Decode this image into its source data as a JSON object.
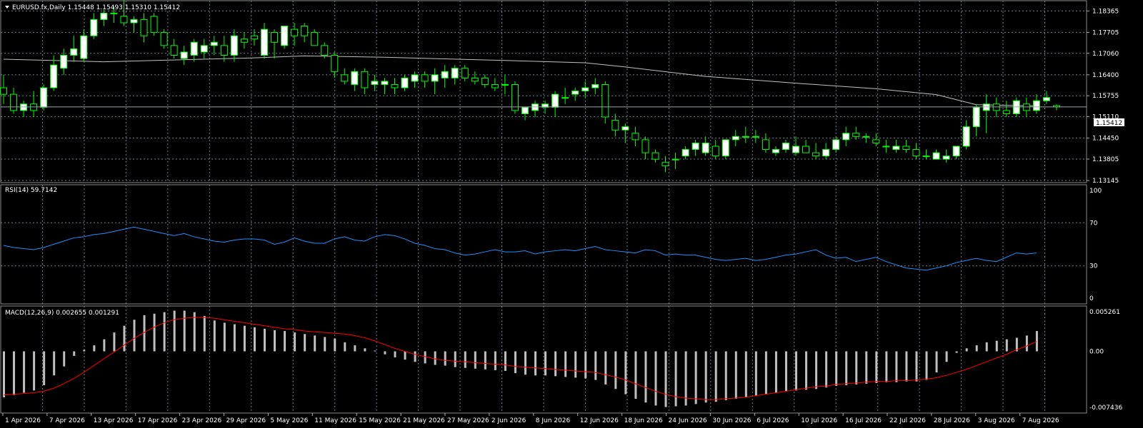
{
  "colors": {
    "background": "#000000",
    "grid": "#6f7f8f",
    "bull_body": "#ffffff",
    "bear_body": "#000000",
    "wick": "#00ff00",
    "ma_line": "#c0c0c0",
    "rsi_line": "#1e90ff",
    "macd_hist": "#c0c0c0",
    "macd_signal": "#ff0000",
    "price_box_bg": "#ffffff",
    "price_box_text": "#000000",
    "text": "#ffffff"
  },
  "header": {
    "price_text": "EURUSD.fx,Daily  1.15448 1.15493 1.15310 1.15412",
    "rsi_text": "RSI(14) 59.7142",
    "macd_text": "MACD(12,26,9) 0.002655 0.001291"
  },
  "price_box": "1.15412",
  "chart_data": [
    {
      "type": "candlestick",
      "symbol": "EURUSD.fx",
      "timeframe": "Daily",
      "yticks": [
        "1.18365",
        "1.17705",
        "1.17060",
        "1.16400",
        "1.15755",
        "1.15110",
        "1.14450",
        "1.13805",
        "1.13145"
      ],
      "ylim": [
        1.1308,
        1.1868
      ],
      "xticks": [
        "1 Apr 2026",
        "7 Apr 2026",
        "13 Apr 2026",
        "17 Apr 2026",
        "23 Apr 2026",
        "29 Apr 2026",
        "5 May 2026",
        "11 May 2026",
        "15 May 2026",
        "21 May 2026",
        "27 May 2026",
        "2 Jun 2026",
        "8 Jun 2026",
        "12 Jun 2026",
        "18 Jun 2026",
        "24 Jun 2026",
        "30 Jun 2026",
        "6 Jul 2026",
        "10 Jul 2026",
        "16 Jul 2026",
        "22 Jul 2026",
        "28 Jul 2026",
        "3 Aug 2026",
        "7 Aug 2026"
      ],
      "ohlc": [
        [
          1.16,
          1.164,
          1.155,
          1.158
        ],
        [
          1.158,
          1.16,
          1.152,
          1.153
        ],
        [
          1.153,
          1.156,
          1.151,
          1.155
        ],
        [
          1.155,
          1.159,
          1.151,
          1.153
        ],
        [
          1.154,
          1.161,
          1.153,
          1.16
        ],
        [
          1.16,
          1.17,
          1.159,
          1.167
        ],
        [
          1.166,
          1.172,
          1.164,
          1.17
        ],
        [
          1.17,
          1.176,
          1.168,
          1.172
        ],
        [
          1.169,
          1.178,
          1.168,
          1.176
        ],
        [
          1.176,
          1.183,
          1.175,
          1.181
        ],
        [
          1.181,
          1.184,
          1.179,
          1.183
        ],
        [
          1.183,
          1.185,
          1.18,
          1.183
        ],
        [
          1.182,
          1.187,
          1.179,
          1.18
        ],
        [
          1.18,
          1.182,
          1.177,
          1.181
        ],
        [
          1.181,
          1.183,
          1.174,
          1.176
        ],
        [
          1.182,
          1.183,
          1.176,
          1.177
        ],
        [
          1.177,
          1.178,
          1.172,
          1.173
        ],
        [
          1.173,
          1.175,
          1.169,
          1.17
        ],
        [
          1.169,
          1.173,
          1.167,
          1.171
        ],
        [
          1.17,
          1.175,
          1.168,
          1.174
        ],
        [
          1.171,
          1.175,
          1.169,
          1.173
        ],
        [
          1.173,
          1.176,
          1.17,
          1.174
        ],
        [
          1.173,
          1.176,
          1.168,
          1.17
        ],
        [
          1.17,
          1.178,
          1.168,
          1.176
        ],
        [
          1.175,
          1.177,
          1.172,
          1.174
        ],
        [
          1.176,
          1.178,
          1.173,
          1.175
        ],
        [
          1.17,
          1.18,
          1.169,
          1.178
        ],
        [
          1.177,
          1.178,
          1.169,
          1.174
        ],
        [
          1.173,
          1.179,
          1.172,
          1.179
        ],
        [
          1.178,
          1.18,
          1.173,
          1.176
        ],
        [
          1.179,
          1.18,
          1.174,
          1.176
        ],
        [
          1.177,
          1.178,
          1.173,
          1.173
        ],
        [
          1.173,
          1.174,
          1.169,
          1.17
        ],
        [
          1.17,
          1.171,
          1.163,
          1.165
        ],
        [
          1.164,
          1.166,
          1.161,
          1.162
        ],
        [
          1.161,
          1.166,
          1.159,
          1.165
        ],
        [
          1.165,
          1.166,
          1.158,
          1.16
        ],
        [
          1.161,
          1.164,
          1.159,
          1.162
        ],
        [
          1.161,
          1.163,
          1.158,
          1.162
        ],
        [
          1.161,
          1.163,
          1.158,
          1.16
        ],
        [
          1.16,
          1.164,
          1.159,
          1.163
        ],
        [
          1.162,
          1.165,
          1.16,
          1.164
        ],
        [
          1.164,
          1.165,
          1.16,
          1.162
        ],
        [
          1.162,
          1.166,
          1.158,
          1.164
        ],
        [
          1.163,
          1.167,
          1.16,
          1.165
        ],
        [
          1.163,
          1.167,
          1.161,
          1.166
        ],
        [
          1.166,
          1.167,
          1.162,
          1.163
        ],
        [
          1.163,
          1.165,
          1.161,
          1.162
        ],
        [
          1.163,
          1.164,
          1.16,
          1.161
        ],
        [
          1.161,
          1.163,
          1.159,
          1.16
        ],
        [
          1.161,
          1.164,
          1.158,
          1.161
        ],
        [
          1.161,
          1.162,
          1.152,
          1.153
        ],
        [
          1.152,
          1.154,
          1.15,
          1.154
        ],
        [
          1.153,
          1.156,
          1.151,
          1.155
        ],
        [
          1.154,
          1.156,
          1.152,
          1.155
        ],
        [
          1.154,
          1.159,
          1.151,
          1.158
        ],
        [
          1.157,
          1.16,
          1.155,
          1.157
        ],
        [
          1.158,
          1.16,
          1.156,
          1.159
        ],
        [
          1.159,
          1.162,
          1.157,
          1.16
        ],
        [
          1.16,
          1.163,
          1.158,
          1.161
        ],
        [
          1.161,
          1.162,
          1.149,
          1.151
        ],
        [
          1.15,
          1.152,
          1.145,
          1.147
        ],
        [
          1.147,
          1.149,
          1.143,
          1.148
        ],
        [
          1.146,
          1.148,
          1.142,
          1.144
        ],
        [
          1.144,
          1.145,
          1.138,
          1.14
        ],
        [
          1.14,
          1.141,
          1.137,
          1.138
        ],
        [
          1.137,
          1.139,
          1.134,
          1.136
        ],
        [
          1.138,
          1.14,
          1.135,
          1.138
        ],
        [
          1.139,
          1.142,
          1.138,
          1.141
        ],
        [
          1.141,
          1.144,
          1.139,
          1.143
        ],
        [
          1.14,
          1.145,
          1.139,
          1.143
        ],
        [
          1.142,
          1.144,
          1.138,
          1.139
        ],
        [
          1.139,
          1.144,
          1.138,
          1.144
        ],
        [
          1.144,
          1.147,
          1.142,
          1.145
        ],
        [
          1.145,
          1.148,
          1.143,
          1.145
        ],
        [
          1.145,
          1.147,
          1.143,
          1.145
        ],
        [
          1.144,
          1.146,
          1.14,
          1.141
        ],
        [
          1.14,
          1.142,
          1.139,
          1.141
        ],
        [
          1.141,
          1.144,
          1.14,
          1.143
        ],
        [
          1.14,
          1.145,
          1.139,
          1.142
        ],
        [
          1.142,
          1.144,
          1.14,
          1.14
        ],
        [
          1.14,
          1.143,
          1.138,
          1.139
        ],
        [
          1.139,
          1.143,
          1.138,
          1.141
        ],
        [
          1.141,
          1.145,
          1.14,
          1.144
        ],
        [
          1.144,
          1.148,
          1.142,
          1.146
        ],
        [
          1.146,
          1.148,
          1.144,
          1.145
        ],
        [
          1.145,
          1.146,
          1.143,
          1.145
        ],
        [
          1.144,
          1.146,
          1.142,
          1.143
        ],
        [
          1.142,
          1.144,
          1.14,
          1.142
        ],
        [
          1.141,
          1.144,
          1.14,
          1.142
        ],
        [
          1.142,
          1.144,
          1.14,
          1.141
        ],
        [
          1.141,
          1.143,
          1.138,
          1.139
        ],
        [
          1.139,
          1.141,
          1.138,
          1.139
        ],
        [
          1.138,
          1.141,
          1.138,
          1.14
        ],
        [
          1.138,
          1.141,
          1.137,
          1.139
        ],
        [
          1.139,
          1.142,
          1.138,
          1.142
        ],
        [
          1.142,
          1.15,
          1.141,
          1.148
        ],
        [
          1.148,
          1.155,
          1.145,
          1.154
        ],
        [
          1.153,
          1.158,
          1.146,
          1.155
        ],
        [
          1.155,
          1.157,
          1.151,
          1.153
        ],
        [
          1.153,
          1.156,
          1.151,
          1.152
        ],
        [
          1.152,
          1.157,
          1.151,
          1.156
        ],
        [
          1.155,
          1.157,
          1.151,
          1.153
        ],
        [
          1.153,
          1.158,
          1.152,
          1.156
        ],
        [
          1.156,
          1.159,
          1.155,
          1.157
        ],
        [
          1.1545,
          1.1549,
          1.1531,
          1.1541
        ]
      ],
      "ma_line": {
        "start": 1.1688,
        "points": [
          [
            0,
            1.1688
          ],
          [
            10,
            1.168
          ],
          [
            25,
            1.1692
          ],
          [
            30,
            1.1698
          ],
          [
            38,
            1.1694
          ],
          [
            50,
            1.1684
          ],
          [
            58,
            1.1677
          ],
          [
            62,
            1.1664
          ],
          [
            70,
            1.1635
          ],
          [
            80,
            1.1612
          ],
          [
            87,
            1.1597
          ],
          [
            93,
            1.1579
          ],
          [
            97,
            1.1548
          ],
          [
            103,
            1.1544
          ]
        ]
      }
    },
    {
      "type": "line",
      "name": "RSI(14)",
      "yticks": [
        "100",
        "70",
        "30",
        "0"
      ],
      "ylim": [
        0,
        100
      ],
      "levels": [
        70,
        30
      ],
      "values": [
        49,
        47,
        46,
        45,
        47,
        50,
        53,
        56,
        57,
        59,
        60,
        62,
        64,
        66,
        64,
        62,
        60,
        58,
        60,
        57,
        55,
        53,
        52,
        54,
        55,
        55,
        54,
        50,
        52,
        56,
        53,
        51,
        51,
        55,
        57,
        54,
        53,
        57,
        59,
        58,
        55,
        51,
        49,
        46,
        45,
        42,
        40,
        41,
        43,
        45,
        43,
        43,
        44,
        41,
        43,
        44,
        45,
        44,
        46,
        48,
        45,
        44,
        43,
        42,
        45,
        44,
        40,
        41,
        40,
        40,
        38,
        36,
        35,
        36,
        37,
        35,
        36,
        38,
        40,
        41,
        43,
        45,
        40,
        37,
        38,
        34,
        36,
        38,
        34,
        31,
        28,
        27,
        26,
        28,
        30,
        33,
        35,
        37,
        35,
        34,
        38,
        42,
        41,
        42
      ]
    },
    {
      "type": "histogram+line",
      "name": "MACD(12,26,9)",
      "yticks": [
        "0.005261",
        "0.00",
        "-0.007436"
      ],
      "ylim": [
        -0.007436,
        0.005261
      ],
      "macd": [
        -0.0061,
        -0.0058,
        -0.0055,
        -0.0052,
        -0.0045,
        -0.0032,
        -0.002,
        -0.0006,
        0.0002,
        0.0008,
        0.0016,
        0.0025,
        0.0034,
        0.0042,
        0.0048,
        0.005,
        0.0052,
        0.0054,
        0.0054,
        0.0052,
        0.0047,
        0.0041,
        0.0038,
        0.0036,
        0.0034,
        0.0032,
        0.003,
        0.0028,
        0.0027,
        0.0025,
        0.0023,
        0.0021,
        0.0019,
        0.0017,
        0.0012,
        0.0008,
        0.0004,
        0.0001,
        -0.0004,
        -0.0008,
        -0.0011,
        -0.0014,
        -0.0016,
        -0.0018,
        -0.0019,
        -0.0021,
        -0.0022,
        -0.0023,
        -0.0024,
        -0.0025,
        -0.0026,
        -0.0029,
        -0.0031,
        -0.0032,
        -0.0032,
        -0.0033,
        -0.0034,
        -0.0035,
        -0.0036,
        -0.0038,
        -0.0044,
        -0.005,
        -0.0057,
        -0.0063,
        -0.0068,
        -0.0072,
        -0.0074,
        -0.0073,
        -0.0072,
        -0.007,
        -0.0068,
        -0.0067,
        -0.0065,
        -0.0063,
        -0.0061,
        -0.0059,
        -0.0057,
        -0.0055,
        -0.0053,
        -0.0052,
        -0.0051,
        -0.005,
        -0.0048,
        -0.0046,
        -0.0045,
        -0.0044,
        -0.0043,
        -0.0042,
        -0.0041,
        -0.0041,
        -0.004,
        -0.004,
        -0.0038,
        -0.0028,
        -0.0014,
        -0.0002,
        0.0004,
        0.0008,
        0.0012,
        0.0014,
        0.0016,
        0.0018,
        0.0021,
        0.0027
      ],
      "signal": [
        -0.0058,
        -0.0057,
        -0.0056,
        -0.0055,
        -0.0053,
        -0.0049,
        -0.0043,
        -0.0036,
        -0.0028,
        -0.0019,
        -0.001,
        -0.0001,
        0.0008,
        0.0017,
        0.0025,
        0.0032,
        0.0038,
        0.0042,
        0.0044,
        0.0045,
        0.0045,
        0.0044,
        0.0042,
        0.004,
        0.0038,
        0.0036,
        0.0034,
        0.0032,
        0.003,
        0.0029,
        0.0027,
        0.0026,
        0.0025,
        0.0024,
        0.0023,
        0.0021,
        0.0018,
        0.0014,
        0.0009,
        0.0004,
        0.0,
        -0.0004,
        -0.0007,
        -0.001,
        -0.0012,
        -0.0013,
        -0.0014,
        -0.0015,
        -0.0016,
        -0.0017,
        -0.0018,
        -0.002,
        -0.0021,
        -0.0022,
        -0.0023,
        -0.0024,
        -0.0025,
        -0.0026,
        -0.0027,
        -0.0028,
        -0.0031,
        -0.0034,
        -0.0038,
        -0.0043,
        -0.0048,
        -0.0053,
        -0.0057,
        -0.006,
        -0.0062,
        -0.0063,
        -0.0064,
        -0.0064,
        -0.0063,
        -0.0062,
        -0.0061,
        -0.0059,
        -0.0057,
        -0.0055,
        -0.0053,
        -0.0051,
        -0.0049,
        -0.0047,
        -0.0046,
        -0.0044,
        -0.0043,
        -0.0042,
        -0.0041,
        -0.004,
        -0.004,
        -0.0039,
        -0.0039,
        -0.0038,
        -0.0037,
        -0.0035,
        -0.0032,
        -0.0028,
        -0.0024,
        -0.0019,
        -0.0014,
        -0.0009,
        -0.0004,
        0.0002,
        0.0007,
        0.0013
      ]
    }
  ]
}
